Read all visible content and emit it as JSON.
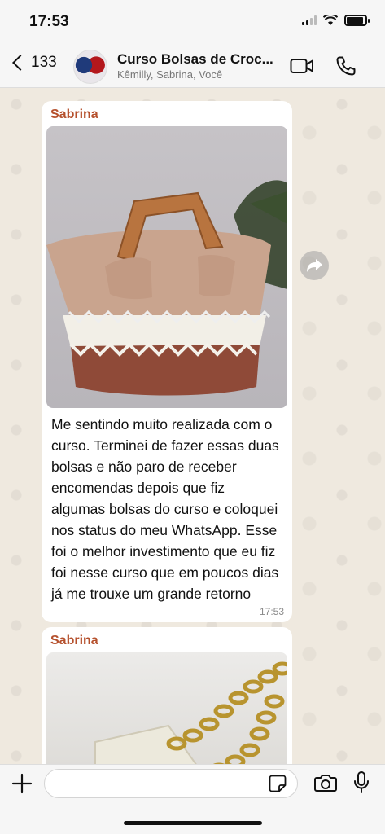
{
  "status_bar": {
    "time": "17:53"
  },
  "header": {
    "back_count": "133",
    "title": "Curso Bolsas de Croc...",
    "subtitle": "Kêmilly, Sabrina, Você"
  },
  "messages": [
    {
      "sender": "Sabrina",
      "text": "Me sentindo muito realizada com o curso. Terminei de fazer essas duas bolsas e não paro de receber encomendas depois que fiz algumas bolsas do curso e coloquei nos status do meu WhatsApp. Esse foi o melhor investimento que eu fiz foi nesse curso que em poucos dias já me trouxe um grande retorno",
      "time": "17:53"
    },
    {
      "sender": "Sabrina"
    }
  ],
  "input": {
    "placeholder": ""
  },
  "colors": {
    "sender": "#b5502c",
    "chat_bg": "#efe9df",
    "bubble": "#ffffff"
  },
  "icons": [
    "back-chevron-icon",
    "video-call-icon",
    "phone-icon",
    "forward-icon",
    "plus-icon",
    "sticker-icon",
    "camera-icon",
    "mic-icon"
  ]
}
